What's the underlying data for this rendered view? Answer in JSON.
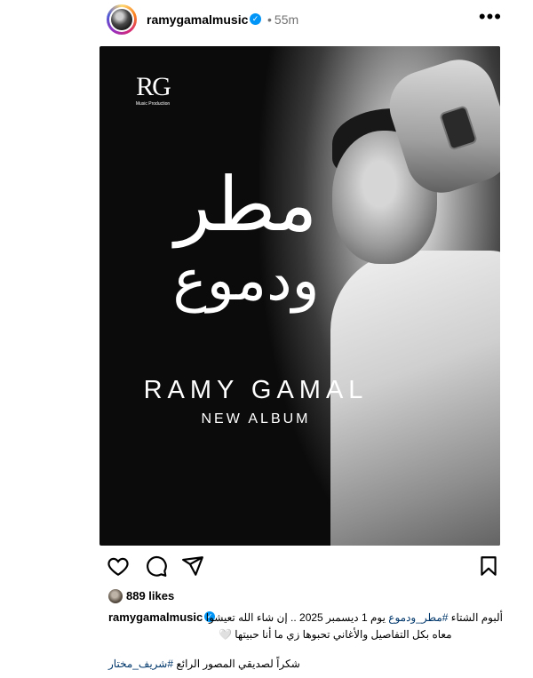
{
  "post": {
    "username": "ramygamalmusic",
    "time": "55m",
    "more_icon": "more-icon",
    "media": {
      "logo_letters": "RG",
      "logo_subtitle": "Music Production",
      "title_line1": "مطر",
      "title_line2": "ودموع",
      "artist": "RAMY GAMAL",
      "album_label": "NEW ALBUM"
    },
    "actions": [
      "heart-icon",
      "comment-icon",
      "share-icon",
      "bookmark-icon"
    ],
    "likes": "889 likes",
    "caption": {
      "username": "ramygamalmusic",
      "line1_start": "ألبوم الشتاء ",
      "line1_tag": "#مطر_ودموع",
      "line1_end": " يوم 1 ديسمبر 2025 .. إن شاء الله تعيشوا",
      "line2": "معاه بكل التفاصيل والأغاني تحبوها زي ما أنا حبيتها 🤍",
      "line3_start": "شكراً لصديقي المصور الرائع ",
      "line3_tag": "#شريف_مختار"
    },
    "colors": {
      "verified": "#0095f6",
      "hashtag": "#00376b",
      "muted": "#737373"
    }
  }
}
